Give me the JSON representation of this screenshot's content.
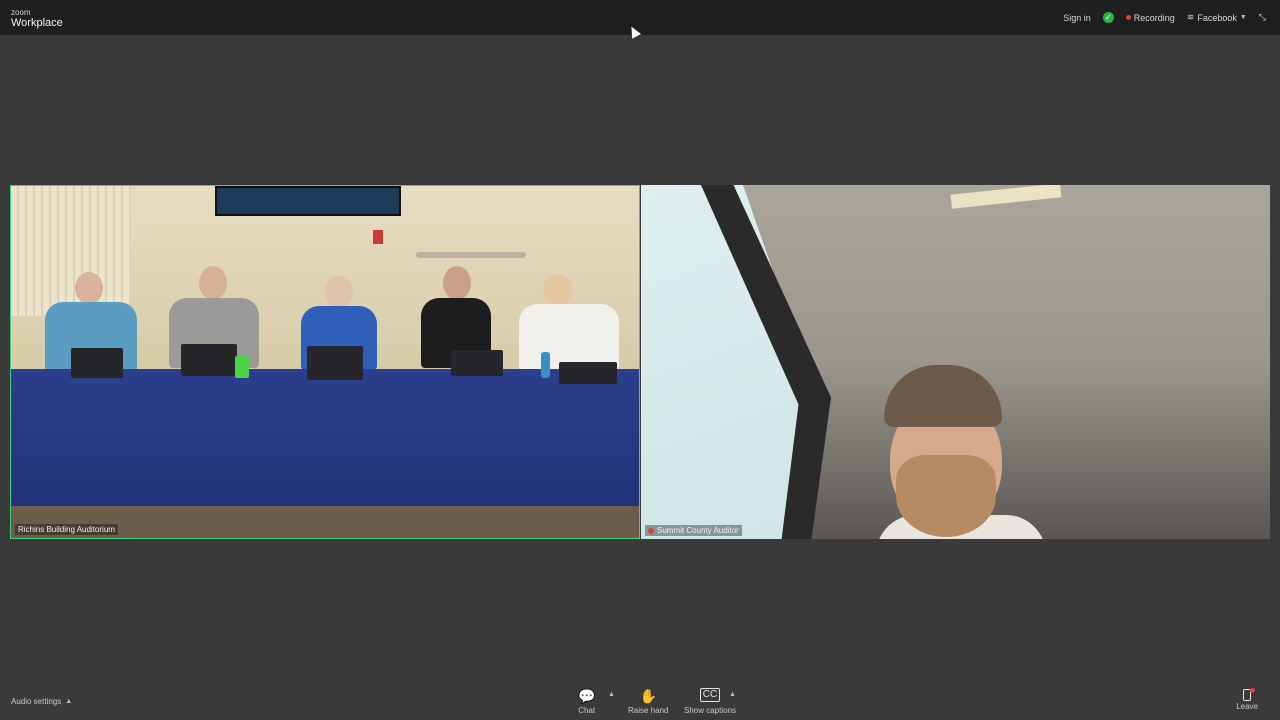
{
  "app": {
    "logo_top": "zoom",
    "logo_bottom": "Workplace"
  },
  "topbar": {
    "sign_in": "Sign in",
    "recording": "Recording",
    "stream": "Facebook",
    "shield_icon": "shield-check-icon",
    "expand_icon": "shrink-arrows-icon",
    "colors": {
      "shield": "#2db34a",
      "recording_dot": "#e0413a"
    }
  },
  "tiles": [
    {
      "label": "Richins Building Auditorium",
      "active_speaker": true,
      "accent": "#3fd07e"
    },
    {
      "label": "Summit County Auditor",
      "muted": true
    }
  ],
  "toolbar": {
    "audio_settings": "Audio settings",
    "chat": "Chat",
    "raise_hand": "Raise hand",
    "captions": "Show captions",
    "leave": "Leave"
  }
}
